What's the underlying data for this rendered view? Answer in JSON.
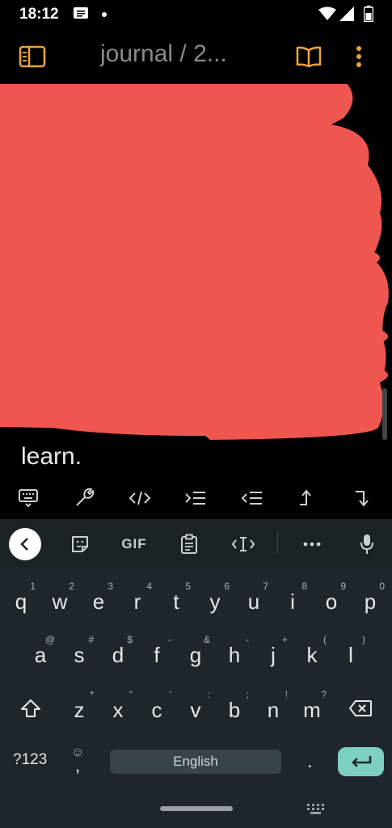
{
  "status_bar": {
    "time": "18:12",
    "icons": [
      "message-icon",
      "notification-dot",
      "wifi-icon",
      "signal-icon",
      "battery-icon"
    ]
  },
  "app_bar": {
    "title": "journal / 2...",
    "icons": [
      "sidebar-toggle-icon",
      "reading-view-icon",
      "more-options-icon"
    ],
    "accent_color": "#e8a33a"
  },
  "content": {
    "visible_text": "learn.",
    "redaction_color": "#ef5650"
  },
  "markdown_toolbar": {
    "tools": [
      "keyboard-hide-icon",
      "wrench-icon",
      "code-icon",
      "indent-icon",
      "outdent-icon",
      "move-up-icon",
      "move-down-icon"
    ]
  },
  "keyboard": {
    "top_tools": {
      "back_icon": "chevron-left-icon",
      "sticker_icon": "sticker-icon",
      "gif_label": "GIF",
      "clipboard_icon": "clipboard-icon",
      "cursor_icon": "text-cursor-icon",
      "more_icon": "more-horizontal-icon",
      "mic_icon": "microphone-icon"
    },
    "row1": [
      {
        "key": "q",
        "hint": "1"
      },
      {
        "key": "w",
        "hint": "2"
      },
      {
        "key": "e",
        "hint": "3"
      },
      {
        "key": "r",
        "hint": "4"
      },
      {
        "key": "t",
        "hint": "5"
      },
      {
        "key": "y",
        "hint": "6"
      },
      {
        "key": "u",
        "hint": "7"
      },
      {
        "key": "i",
        "hint": "8"
      },
      {
        "key": "o",
        "hint": "9"
      },
      {
        "key": "p",
        "hint": "0"
      }
    ],
    "row2": [
      {
        "key": "a",
        "hint": "@"
      },
      {
        "key": "s",
        "hint": "#"
      },
      {
        "key": "d",
        "hint": "$"
      },
      {
        "key": "f",
        "hint": "-"
      },
      {
        "key": "g",
        "hint": "&"
      },
      {
        "key": "h",
        "hint": "-"
      },
      {
        "key": "j",
        "hint": "+"
      },
      {
        "key": "k",
        "hint": "("
      },
      {
        "key": "l",
        "hint": ")"
      }
    ],
    "row3": [
      {
        "key": "z",
        "hint": "*"
      },
      {
        "key": "x",
        "hint": "\""
      },
      {
        "key": "c",
        "hint": "'"
      },
      {
        "key": "v",
        "hint": ":"
      },
      {
        "key": "b",
        "hint": ";"
      },
      {
        "key": "n",
        "hint": "!"
      },
      {
        "key": "m",
        "hint": "?"
      }
    ],
    "symbols_label": "?123",
    "emoji_hint": "☺",
    "comma_label": ",",
    "space_label": "English",
    "period_label": ".",
    "enter_color": "#7dd0c1"
  }
}
